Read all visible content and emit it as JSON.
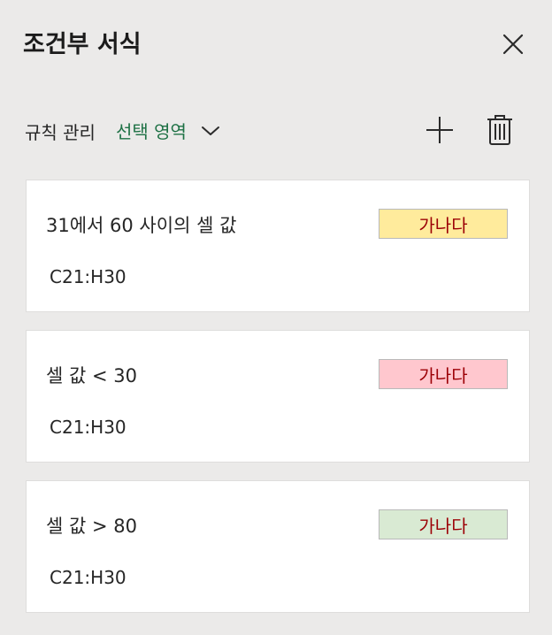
{
  "pane": {
    "title": "조건부 서식",
    "close_icon": "close-icon"
  },
  "toolbar": {
    "manage_rules_label": "규칙 관리",
    "scope_value": "선택 영역",
    "scope_icon": "chevron-down-icon",
    "add_icon": "plus-icon",
    "delete_icon": "trash-icon"
  },
  "rules": [
    {
      "description": "31에서 60 사이의 셀 값",
      "range": "C21:H30",
      "preview_text": "가나다",
      "preview_fill": "#ffeb9c",
      "preview_font_color": "#9c0006"
    },
    {
      "description": "셀 값 < 30",
      "range": "C21:H30",
      "preview_text": "가나다",
      "preview_fill": "#ffc7ce",
      "preview_font_color": "#9c0006"
    },
    {
      "description": "셀 값 > 80",
      "range": "C21:H30",
      "preview_text": "가나다",
      "preview_fill": "#d9ead3",
      "preview_font_color": "#9c0006"
    }
  ],
  "colors": {
    "background": "#ebeae9",
    "accent_green": "#1e7145",
    "card": "#ffffff"
  }
}
